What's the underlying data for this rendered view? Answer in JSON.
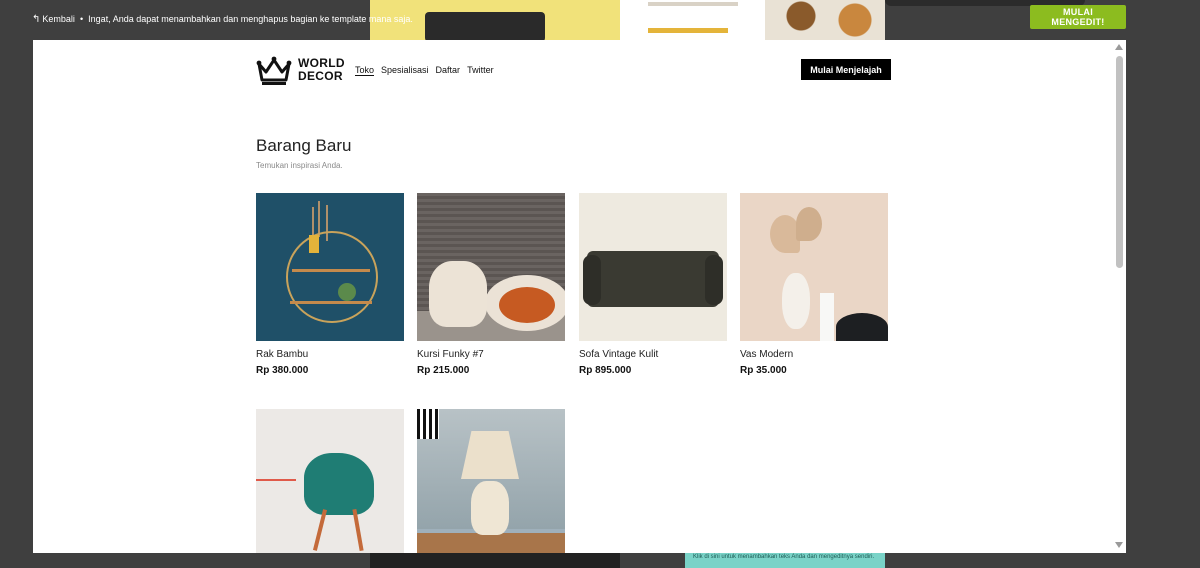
{
  "topbar": {
    "back_label": "Kembali",
    "separator": "•",
    "notice": "Ingat, Anda dapat menambahkan dan menghapus bagian ke template mana saja.",
    "cta": "MULAI MENGEDIT!"
  },
  "site": {
    "logo_line1": "WORLD",
    "logo_line2": "DECOR",
    "nav": [
      "Toko",
      "Spesialisasi",
      "Daftar",
      "Twitter"
    ],
    "active_nav": "Toko",
    "explore_button": "Mulai Menjelajah"
  },
  "section": {
    "title": "Barang Baru",
    "subtitle": "Temukan inspirasi Anda."
  },
  "products": [
    {
      "name": "Rak Bambu",
      "price": "Rp 380.000"
    },
    {
      "name": "Kursi Funky #7",
      "price": "Rp 215.000"
    },
    {
      "name": "Sofa Vintage Kulit",
      "price": "Rp 895.000"
    },
    {
      "name": "Vas Modern",
      "price": "Rp 35.000"
    },
    {
      "name": "",
      "price": ""
    },
    {
      "name": "",
      "price": ""
    }
  ],
  "background": {
    "caption": "Klik di sini untuk menambahkan teks Anda dan mengeditnya sendiri."
  },
  "colors": {
    "overlay": "#3f3f3f",
    "cta_green": "#8cbc1f",
    "explore_black": "#000000"
  },
  "icons": {
    "back": "undo-arrow-icon",
    "logo": "crown-icon",
    "scroll_up": "triangle-up-icon",
    "scroll_down": "triangle-down-icon"
  }
}
